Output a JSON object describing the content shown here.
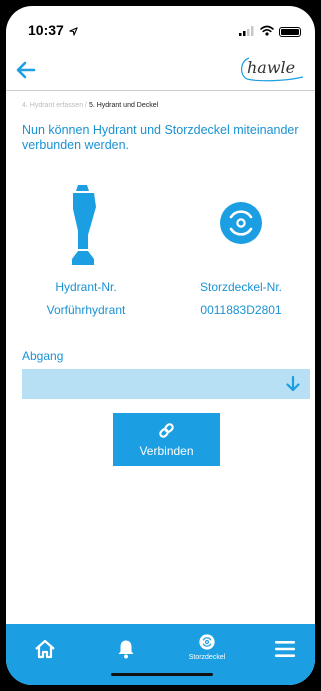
{
  "status_bar": {
    "time": "10:37"
  },
  "header": {
    "logo_text": "hawle"
  },
  "breadcrumb": {
    "previous": "4. Hydrant erfassen",
    "separator": " / ",
    "current": "5. Hydrant und Deckel"
  },
  "intro_text": "Nun können Hydrant und Storzdeckel miteinander verbunden werden.",
  "hydrant": {
    "label": "Hydrant-Nr.",
    "value": "Vorführhydrant"
  },
  "storzdeckel": {
    "label": "Storzdeckel-Nr.",
    "value": "0011883D2801"
  },
  "abgang": {
    "label": "Abgang",
    "value": ""
  },
  "connect_button": {
    "label": "Verbinden"
  },
  "tabs": [
    {
      "icon": "home-icon",
      "label": ""
    },
    {
      "icon": "bell-icon",
      "label": ""
    },
    {
      "icon": "storzdeckel-icon",
      "label": "Storzdeckel"
    },
    {
      "icon": "menu-icon",
      "label": ""
    }
  ],
  "colors": {
    "accent": "#1c9ee3",
    "text_accent": "#1a92d4",
    "dropdown_bg": "#b7e0f4"
  }
}
